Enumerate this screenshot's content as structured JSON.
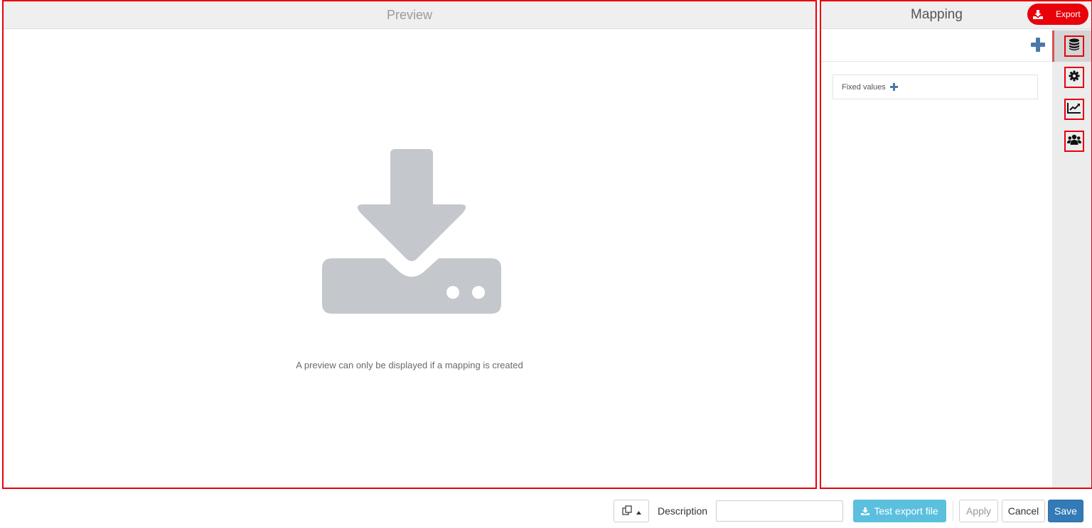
{
  "preview": {
    "title": "Preview",
    "empty_message": "A preview can only be displayed if a mapping is created"
  },
  "mapping": {
    "title": "Mapping",
    "export_label": "Export",
    "fixed_values_label": "Fixed values",
    "rail_icons": [
      "database-icon",
      "gear-icon",
      "line-chart-icon",
      "users-icon"
    ]
  },
  "footer": {
    "description_label": "Description",
    "description_value": "",
    "test_export_label": "Test export file",
    "apply_label": "Apply",
    "cancel_label": "Cancel",
    "save_label": "Save"
  },
  "colors": {
    "accent_red": "#e8000b",
    "info_blue": "#5bc0de",
    "primary_blue": "#337ab7",
    "plus_blue": "#4a78a8"
  }
}
